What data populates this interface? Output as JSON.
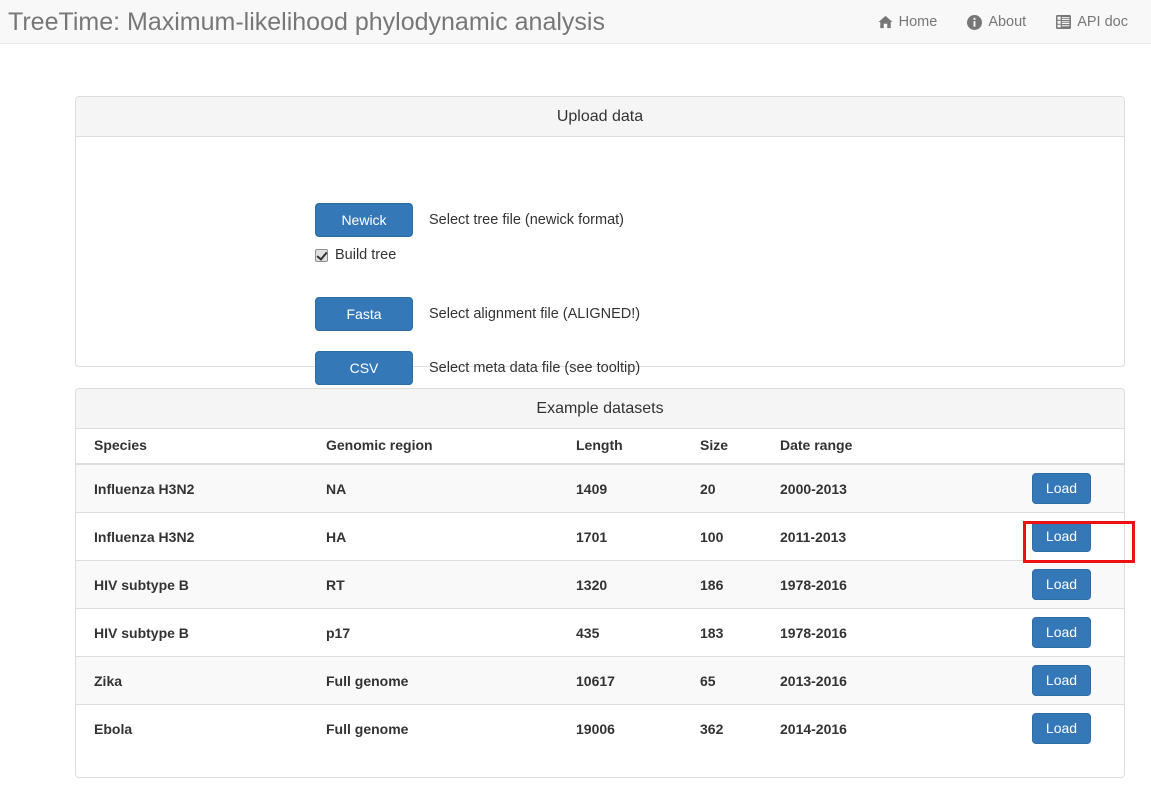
{
  "navbar": {
    "brand": "TreeTime: Maximum-likelihood phylodynamic analysis",
    "links": [
      {
        "label": "Home",
        "icon": "home-icon"
      },
      {
        "label": "About",
        "icon": "info-circle-icon"
      },
      {
        "label": "API doc",
        "icon": "list-alt-icon"
      }
    ]
  },
  "upload_panel": {
    "title": "Upload data",
    "newick_button": "Newick",
    "newick_desc": "Select tree file (newick format)",
    "build_tree_label": "Build tree",
    "build_tree_checked": true,
    "fasta_button": "Fasta",
    "fasta_desc": "Select alignment file (ALIGNED!)",
    "csv_button": "CSV",
    "csv_desc": "Select meta data file (see tooltip)"
  },
  "examples_panel": {
    "title": "Example datasets",
    "columns": [
      "Species",
      "Genomic region",
      "Length",
      "Size",
      "Date range",
      ""
    ],
    "load_label": "Load",
    "highlighted_row_index": 1,
    "rows": [
      {
        "species": "Influenza H3N2",
        "region": "NA",
        "length": "1409",
        "size": "20",
        "date_range": "2000-2013"
      },
      {
        "species": "Influenza H3N2",
        "region": "HA",
        "length": "1701",
        "size": "100",
        "date_range": "2011-2013"
      },
      {
        "species": "HIV subtype B",
        "region": "RT",
        "length": "1320",
        "size": "186",
        "date_range": "1978-2016"
      },
      {
        "species": "HIV subtype B",
        "region": "p17",
        "length": "435",
        "size": "183",
        "date_range": "1978-2016"
      },
      {
        "species": "Zika",
        "region": "Full genome",
        "length": "10617",
        "size": "65",
        "date_range": "2013-2016"
      },
      {
        "species": "Ebola",
        "region": "Full genome",
        "length": "19006",
        "size": "362",
        "date_range": "2014-2016"
      }
    ]
  },
  "colors": {
    "primary_button": "#3578b8",
    "navbar_bg": "#f8f8f8",
    "panel_heading_bg": "#f5f5f5",
    "highlight_box": "#ee1111",
    "text": "#333333",
    "muted_text": "#777777"
  }
}
